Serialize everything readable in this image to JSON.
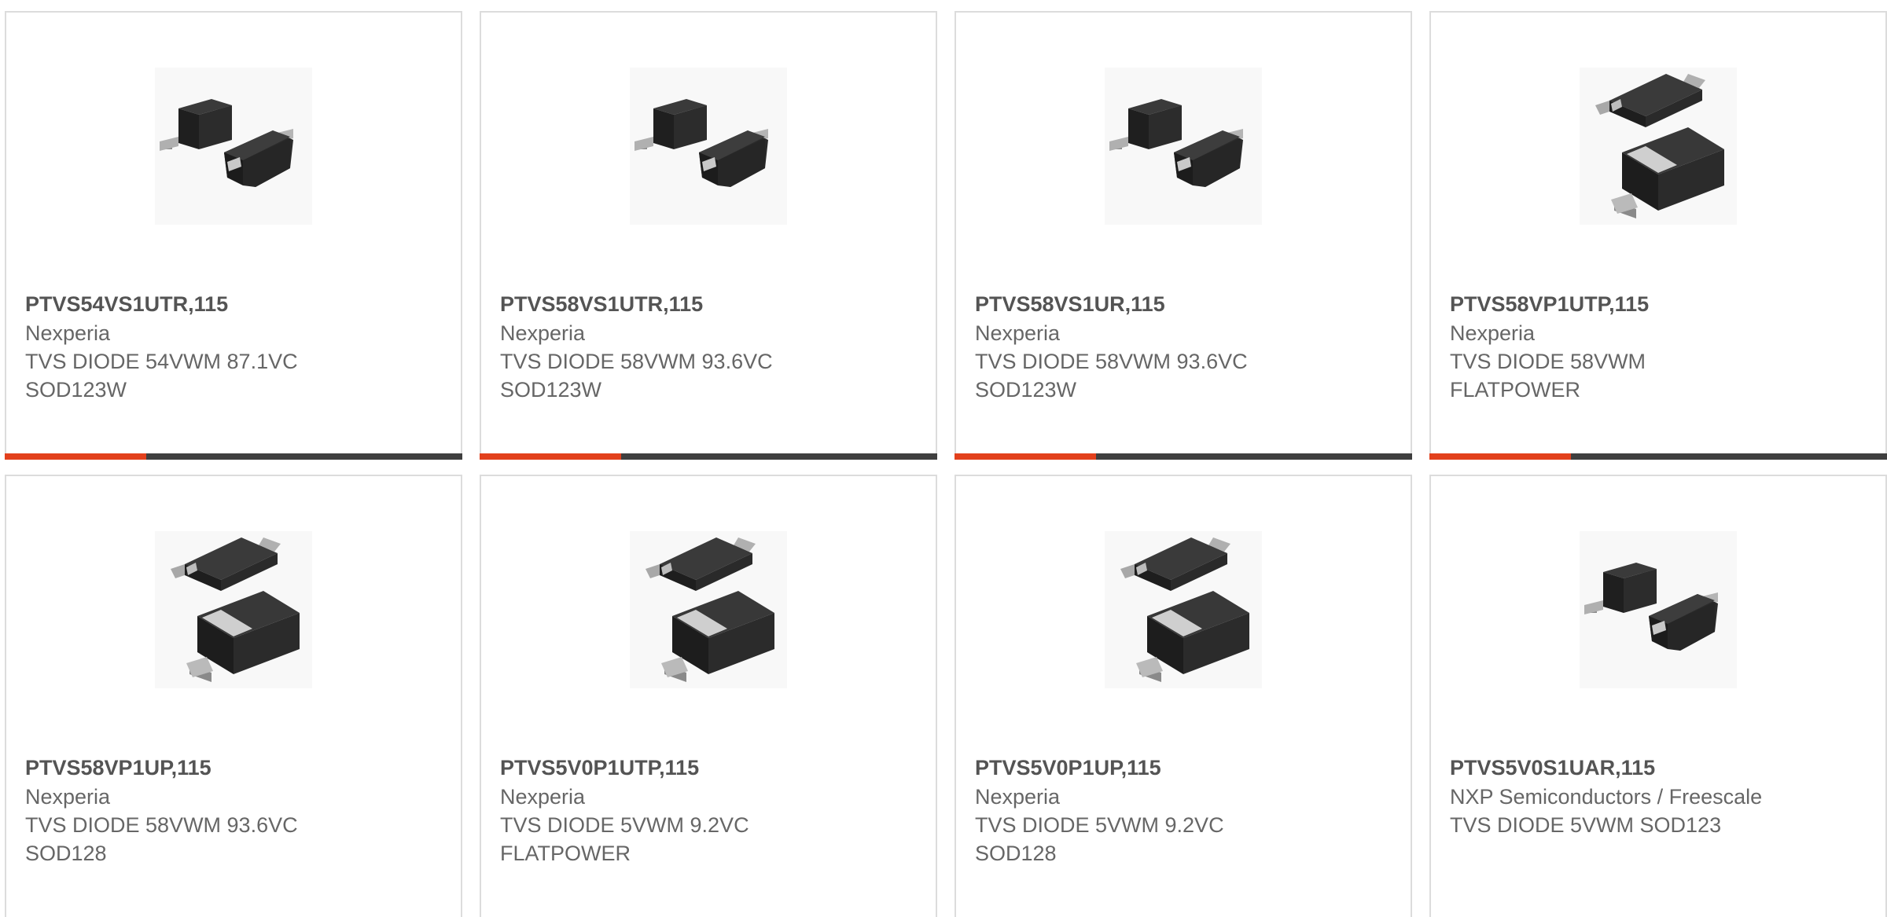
{
  "colors": {
    "accent": "#e2401c",
    "bar_dark": "#3f3f3f",
    "border": "#dcdcdc",
    "part_number_text": "#545454",
    "body_text": "#666666"
  },
  "products": [
    {
      "part_number": "PTVS54VS1UTR,115",
      "manufacturer": "Nexperia",
      "description": "TVS DIODE 54VWM 87.1VC SOD123W",
      "image_icon": "sod123-package-icon",
      "accent_fraction": 0.31
    },
    {
      "part_number": "PTVS58VS1UTR,115",
      "manufacturer": "Nexperia",
      "description": "TVS DIODE 58VWM 93.6VC SOD123W",
      "image_icon": "sod123-package-icon",
      "accent_fraction": 0.31
    },
    {
      "part_number": "PTVS58VS1UR,115",
      "manufacturer": "Nexperia",
      "description": "TVS DIODE 58VWM 93.6VC SOD123W",
      "image_icon": "sod123-package-icon",
      "accent_fraction": 0.31
    },
    {
      "part_number": "PTVS58VP1UTP,115",
      "manufacturer": "Nexperia",
      "description": "TVS DIODE 58VWM FLATPOWER",
      "image_icon": "flatpower-package-icon",
      "accent_fraction": 0.31
    },
    {
      "part_number": "PTVS58VP1UP,115",
      "manufacturer": "Nexperia",
      "description": "TVS DIODE 58VWM 93.6VC SOD128",
      "image_icon": "flatpower-package-icon"
    },
    {
      "part_number": "PTVS5V0P1UTP,115",
      "manufacturer": "Nexperia",
      "description": "TVS DIODE 5VWM 9.2VC FLATPOWER",
      "image_icon": "flatpower-package-icon"
    },
    {
      "part_number": "PTVS5V0P1UP,115",
      "manufacturer": "Nexperia",
      "description": "TVS DIODE 5VWM 9.2VC SOD128",
      "image_icon": "flatpower-package-icon"
    },
    {
      "part_number": "PTVS5V0S1UAR,115",
      "manufacturer": "NXP Semiconductors / Freescale",
      "description": "TVS DIODE 5VWM SOD123",
      "image_icon": "sod123-package-icon"
    }
  ]
}
